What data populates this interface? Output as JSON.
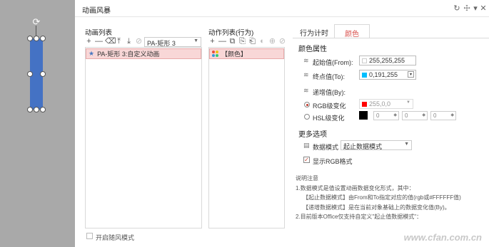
{
  "window": {
    "title": "动画风暴",
    "controls": [
      "↻",
      "☩",
      "▾",
      "✕"
    ]
  },
  "animation_list": {
    "header": "动画列表",
    "toolbar_icons": [
      "plus-icon",
      "minus-icon",
      "trash-icon",
      "move-top-icon",
      "move-bottom-icon",
      "link-icon"
    ],
    "toolbar_glyphs": [
      "+",
      "—",
      "🗑",
      "⤒",
      "⤓",
      "⊘"
    ],
    "shape_select": "PA-矩形 3",
    "items": [
      {
        "label": "PA-矩形 3:自定义动画",
        "selected": true
      }
    ]
  },
  "action_list": {
    "header": "动作列表(行为)",
    "toolbar_glyphs": [
      "+",
      "—",
      "⧉",
      "⎘",
      "⎗",
      "◐",
      "⊕",
      "⊘"
    ],
    "items": [
      {
        "label": "【颜色】",
        "selected": true
      }
    ]
  },
  "tabs": [
    {
      "label": "行为计时",
      "active": false
    },
    {
      "label": "颜色",
      "active": true
    }
  ],
  "color_props": {
    "section_title": "颜色属性",
    "start_label": "起始值(From):",
    "start_value": "255,255,255",
    "start_color": "#ffffff",
    "end_label": "终点值(To):",
    "end_value": "0,191,255",
    "end_color": "#00bfff",
    "increment_label": "递增值(By):",
    "rgb_label": "RGB级变化",
    "rgb_value": "255,0,0",
    "rgb_color": "#ff0000",
    "hsl_label": "HSL级变化",
    "hsl_color": "#000000",
    "hsl_values": [
      "0",
      "0",
      "0"
    ]
  },
  "more_options": {
    "section_title": "更多选项",
    "data_mode_label": "数据模式",
    "data_mode_value": "起止数据模式",
    "show_rgb_label": "显示RGB格式",
    "show_rgb_checked": true
  },
  "notes": {
    "title": "说明注意",
    "lines": [
      "1.数据模式是值设置动画数据变化形式，其中：",
      "【起止数据模式】由From和To指定对应的值(rgb或#FFFFFF值)",
      "【递增数据模式】是在当前对象基础上的数据变化值(By)。",
      "2.目前版本Office仅支持自定义\"起止值数据模式\"："
    ]
  },
  "footer": {
    "storm_mode_label": "开启随风模式"
  },
  "watermark": "www.cfan.com.cn"
}
